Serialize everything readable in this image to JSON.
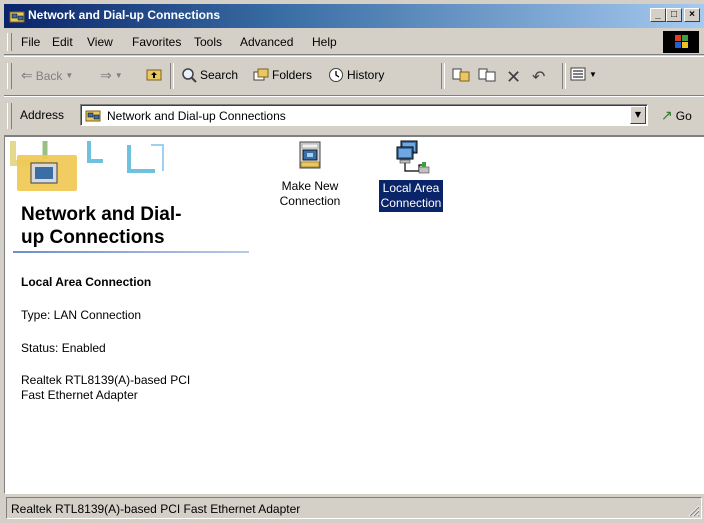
{
  "window": {
    "title": "Network and Dial-up Connections",
    "controls": {
      "minimize": "_",
      "maximize": "□",
      "close": "×"
    }
  },
  "menu": {
    "items": [
      "File",
      "Edit",
      "View",
      "Favorites",
      "Tools",
      "Advanced",
      "Help"
    ]
  },
  "toolbar": {
    "back": "Back",
    "search": "Search",
    "folders": "Folders",
    "history": "History"
  },
  "address": {
    "label": "Address",
    "value": "Network and Dial-up Connections",
    "go": "Go"
  },
  "banner": {
    "title_line1": "Network and Dial-",
    "title_line2": "up Connections"
  },
  "details": {
    "heading": "Local Area Connection",
    "type": "Type: LAN Connection",
    "status": "Status: Enabled",
    "adapter_line1": "Realtek RTL8139(A)-based PCI",
    "adapter_line2": "Fast Ethernet Adapter"
  },
  "items": [
    {
      "line1": "Make New",
      "line2": "Connection",
      "icon": "make-new-connection-icon",
      "selected": false
    },
    {
      "line1": "Local Area",
      "line2": "Connection",
      "icon": "local-area-connection-icon",
      "selected": true
    }
  ],
  "statusbar": {
    "text": "Realtek RTL8139(A)-based PCI Fast Ethernet Adapter"
  },
  "colors": {
    "title_active": "#0a246a",
    "face": "#d4d0c8",
    "selection": "#0a246a"
  }
}
